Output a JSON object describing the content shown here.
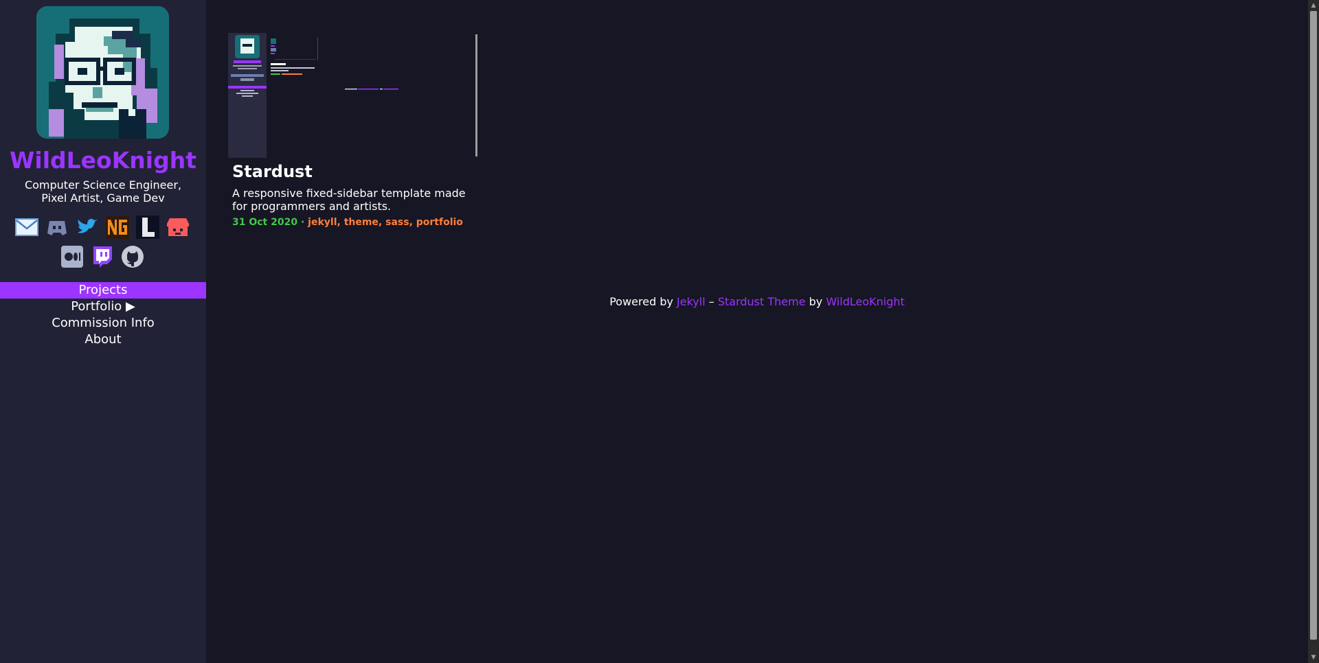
{
  "sidebar": {
    "title": "WildLeoKnight",
    "tagline": "Computer Science Engineer, Pixel Artist, Game Dev",
    "social_icons": [
      "email-icon",
      "discord-icon",
      "twitter-icon",
      "newgrounds-icon",
      "lospec-icon",
      "itchio-icon",
      "medium-icon",
      "twitch-icon",
      "github-icon"
    ],
    "nav": [
      {
        "label": "Projects",
        "active": true
      },
      {
        "label": "Portfolio ▶"
      },
      {
        "label": "Commission Info"
      },
      {
        "label": "About"
      }
    ]
  },
  "posts": [
    {
      "title": "Stardust",
      "description": "A responsive fixed-sidebar template made for programmers and artists.",
      "date": "31 Oct 2020",
      "separator": " · ",
      "tags": "jekyll, theme, sass, portfolio"
    }
  ],
  "footer": {
    "prefix": "Powered by ",
    "jekyll": "Jekyll",
    "dash": " – ",
    "theme": "Stardust Theme",
    "by": " by ",
    "author": "WildLeoKnight"
  },
  "colors": {
    "accent": "#9b35ff",
    "background": "#161624",
    "sidebar": "#222236",
    "date": "#44c74b",
    "tags": "#ff7f3a"
  }
}
